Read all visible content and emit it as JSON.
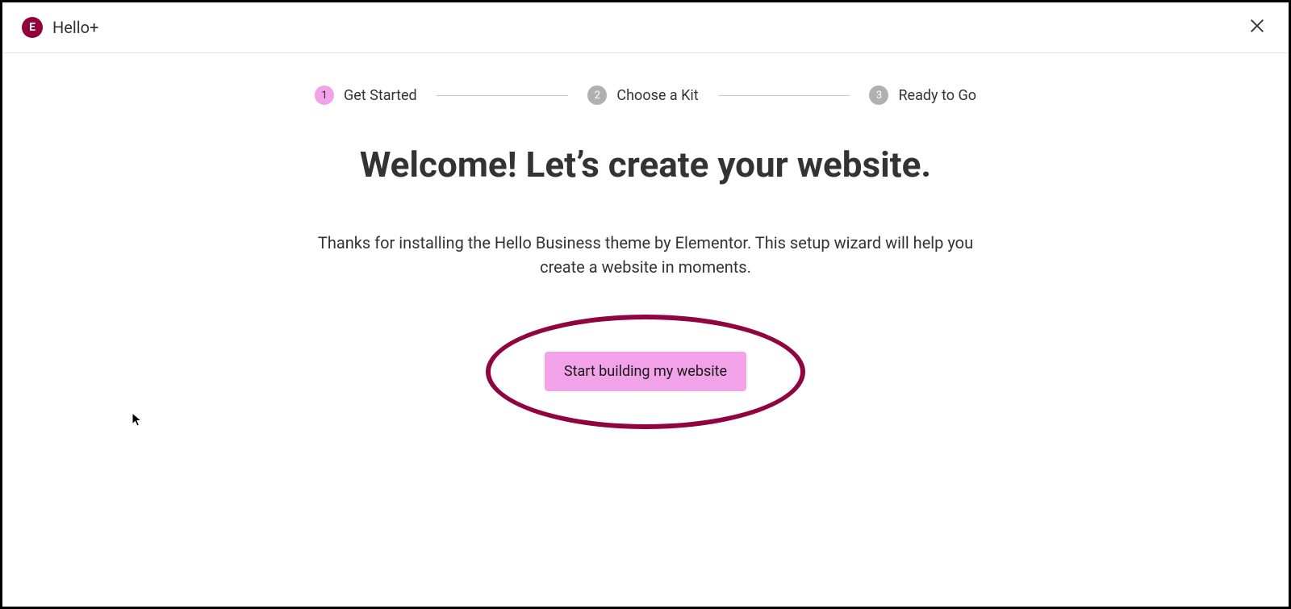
{
  "header": {
    "app_title": "Hello+",
    "logo_glyph": "E"
  },
  "stepper": {
    "steps": [
      {
        "number": "1",
        "label": "Get Started",
        "active": true
      },
      {
        "number": "2",
        "label": "Choose a Kit",
        "active": false
      },
      {
        "number": "3",
        "label": "Ready to Go",
        "active": false
      }
    ]
  },
  "main": {
    "heading": "Welcome! Let’s create your website.",
    "description": "Thanks for installing the Hello Business theme by Elementor. This setup wizard will help you create a website in moments.",
    "cta_label": "Start building my website"
  },
  "colors": {
    "brand_dark": "#92003b",
    "accent_pink": "#f2a2e8",
    "annotation": "#8f0441",
    "step_inactive": "#b0b0b0"
  }
}
